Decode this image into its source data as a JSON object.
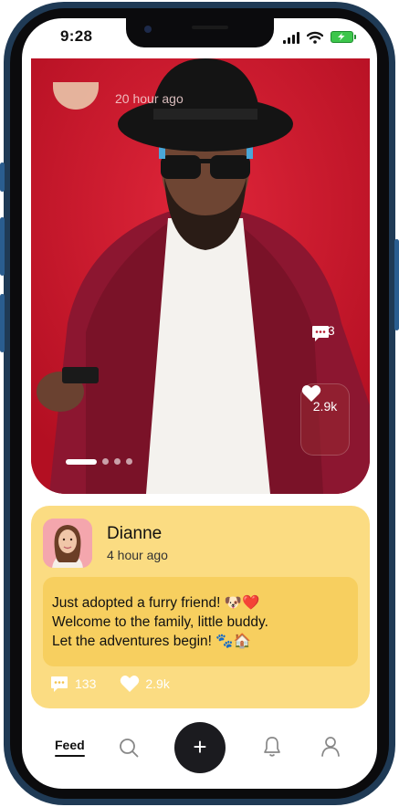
{
  "status_bar": {
    "time": "9:28"
  },
  "post_top": {
    "time_ago": "20 hour ago",
    "carousel": {
      "count": 4,
      "active_index": 0
    },
    "comments": "133",
    "likes": "2.9k"
  },
  "post_card": {
    "author": "Dianne",
    "time_ago": "4 hour ago",
    "message_lines": [
      "Just adopted a furry friend! 🐶❤️",
      "Welcome to the family, little buddy.",
      "Let the adventures begin! 🐾🏠"
    ],
    "comments": "133",
    "likes": "2.9k"
  },
  "bottom_nav": {
    "feed_label": "Feed",
    "add_label": "+"
  },
  "colors": {
    "card": "#fbdc82",
    "bubble": "#f7cf5f",
    "photo_bg": "#c8182a",
    "nav_button": "#1b1b1f"
  }
}
